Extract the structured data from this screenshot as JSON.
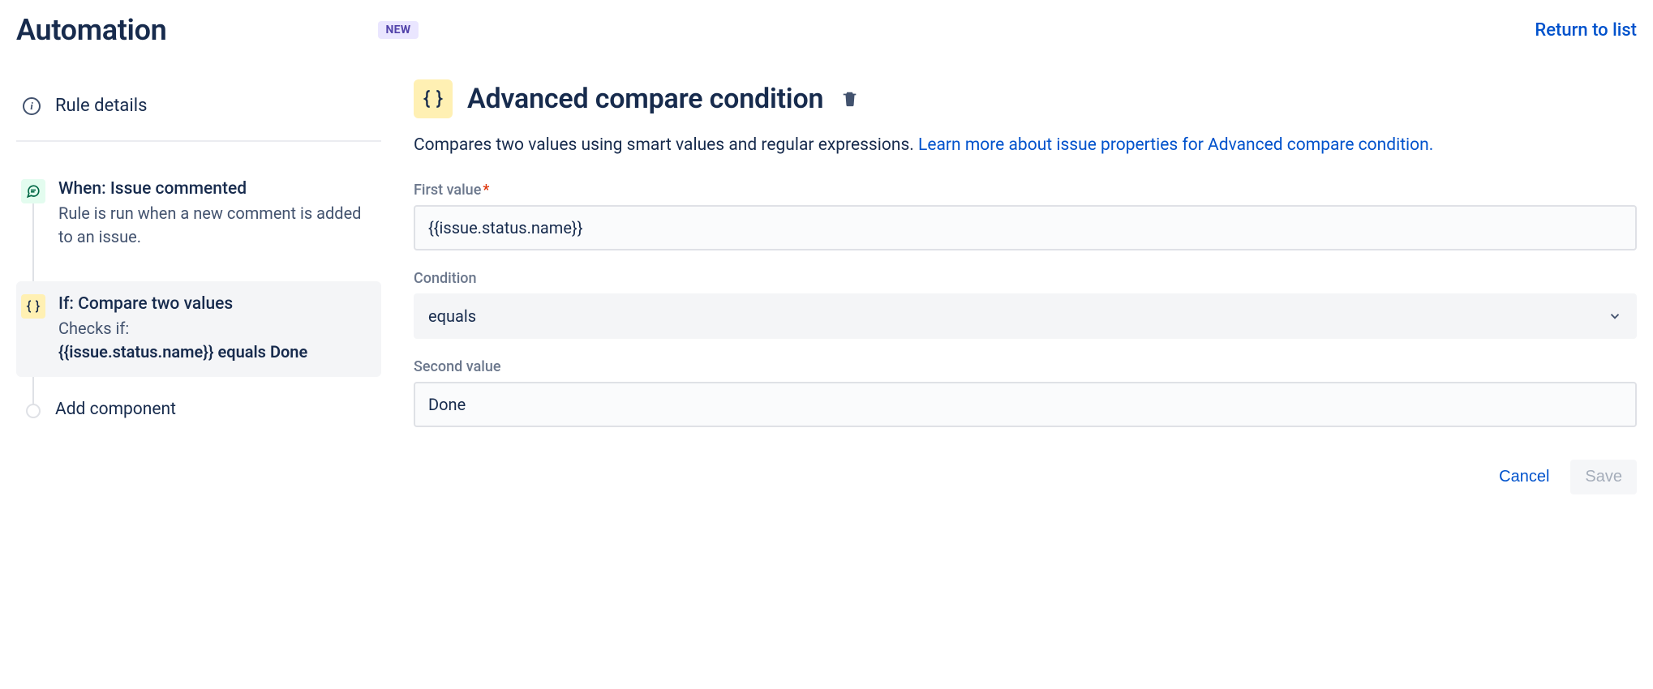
{
  "header": {
    "title": "Automation",
    "badge": "NEW",
    "return_link": "Return to list"
  },
  "sidebar": {
    "rule_details_label": "Rule details",
    "trigger": {
      "title": "When: Issue commented",
      "desc": "Rule is run when a new comment is added to an issue."
    },
    "condition": {
      "title": "If: Compare two values",
      "desc_prefix": "Checks if:",
      "expr": "{{issue.status.name}}",
      "op": "equals",
      "val": "Done"
    },
    "add_component": "Add component"
  },
  "main": {
    "title": "Advanced compare condition",
    "desc_plain": "Compares two values using smart values and regular expressions. ",
    "desc_link": "Learn more about issue properties for Advanced compare condition.",
    "fields": {
      "first_value": {
        "label": "First value",
        "value": "{{issue.status.name}}"
      },
      "condition": {
        "label": "Condition",
        "value": "equals"
      },
      "second_value": {
        "label": "Second value",
        "value": "Done"
      }
    },
    "actions": {
      "cancel": "Cancel",
      "save": "Save"
    }
  }
}
